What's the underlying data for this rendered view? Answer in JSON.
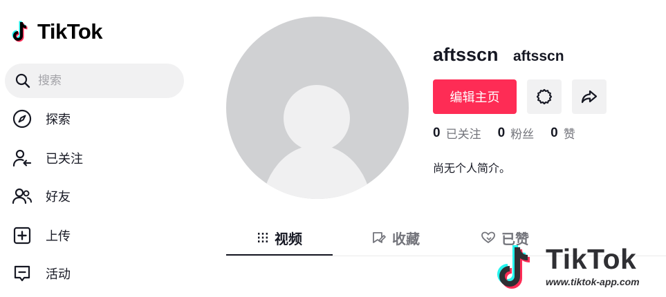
{
  "brand": {
    "name": "TikTok"
  },
  "search": {
    "placeholder": "搜索"
  },
  "nav": [
    {
      "label": "探索",
      "icon": "compass-icon"
    },
    {
      "label": "已关注",
      "icon": "following-icon"
    },
    {
      "label": "好友",
      "icon": "friends-icon"
    },
    {
      "label": "上传",
      "icon": "upload-icon"
    },
    {
      "label": "活动",
      "icon": "activity-icon"
    }
  ],
  "profile": {
    "username": "aftsscn",
    "nickname": "aftsscn",
    "edit_label": "编辑主页",
    "settings_icon": "gear-icon",
    "share_icon": "share-icon",
    "stats": [
      {
        "value": "0",
        "label": "已关注"
      },
      {
        "value": "0",
        "label": "粉丝"
      },
      {
        "value": "0",
        "label": "赞"
      }
    ],
    "bio": "尚无个人简介。"
  },
  "tabs": [
    {
      "label": "视频",
      "icon": "grid-icon",
      "active": true
    },
    {
      "label": "收藏",
      "icon": "bookmark-icon",
      "active": false
    },
    {
      "label": "已赞",
      "icon": "heart-icon",
      "active": false
    }
  ],
  "watermark": {
    "text": "TikTok",
    "url": "www.tiktok-app.com"
  },
  "colors": {
    "accent": "#fe2c55",
    "cyan": "#25f4ee",
    "text": "#161823",
    "muted": "#73747b"
  }
}
